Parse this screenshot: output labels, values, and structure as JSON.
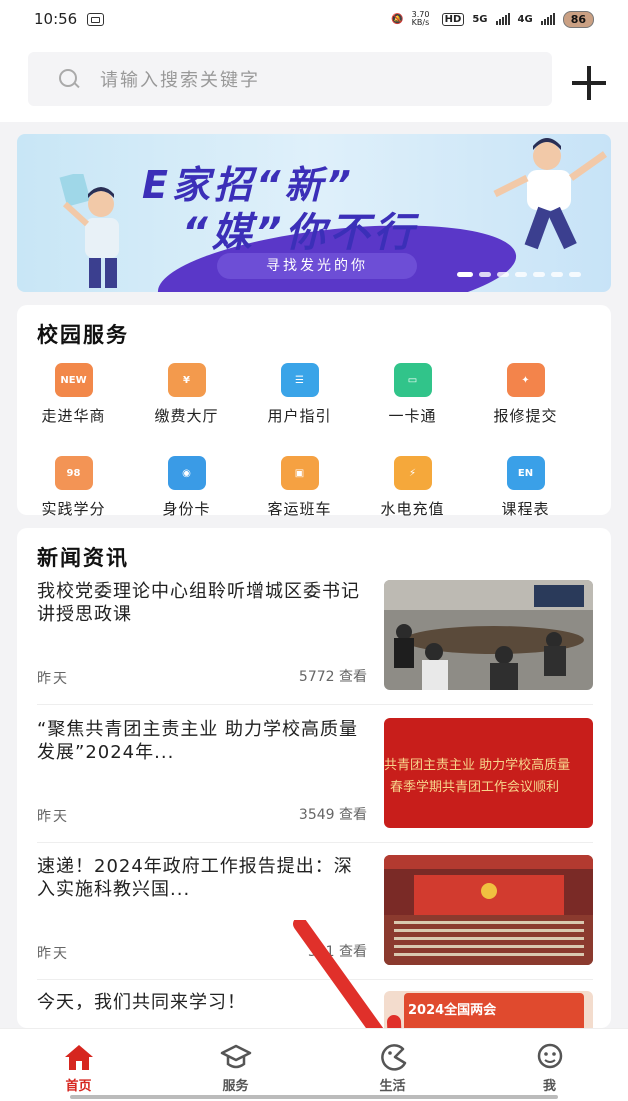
{
  "status_bar": {
    "time": "10:56",
    "speed": "3.70 KB/s",
    "battery": "86",
    "net_labels": [
      "HD",
      "5G",
      "4G"
    ]
  },
  "search": {
    "placeholder": "请输入搜索关键字",
    "icon": "search-icon",
    "add_icon": "plus-icon"
  },
  "banner": {
    "line1": "E家招“新”",
    "line2": "“媒”你不行",
    "subtitle": "寻找发光的你",
    "slide_count": 7,
    "active_slide": 1
  },
  "campus_services": {
    "title": "校园服务",
    "items": [
      {
        "label": "走进华商",
        "icon": "new-icon",
        "color": "#f2884a",
        "glyph": "NEW"
      },
      {
        "label": "缴费大厅",
        "icon": "payment-icon",
        "color": "#f39a4d",
        "glyph": "¥"
      },
      {
        "label": "用户指引",
        "icon": "guide-icon",
        "color": "#3aa4e8",
        "glyph": "☰"
      },
      {
        "label": "一卡通",
        "icon": "card-icon",
        "color": "#31c48a",
        "glyph": "▭"
      },
      {
        "label": "报修提交",
        "icon": "repair-icon",
        "color": "#f3844b",
        "glyph": "✦"
      },
      {
        "label": "实践学分",
        "icon": "credit-icon",
        "color": "#f39455",
        "glyph": "98"
      },
      {
        "label": "身份卡",
        "icon": "id-card-icon",
        "color": "#3a9be6",
        "glyph": "◉"
      },
      {
        "label": "客运班车",
        "icon": "bus-icon",
        "color": "#f5a142",
        "glyph": "▣"
      },
      {
        "label": "水电充值",
        "icon": "utility-icon",
        "color": "#f5a83b",
        "glyph": "⚡"
      },
      {
        "label": "课程表",
        "icon": "schedule-icon",
        "color": "#3aa0e8",
        "glyph": "EN"
      }
    ]
  },
  "news": {
    "title": "新闻资讯",
    "items": [
      {
        "title": "我校党委理论中心组聆听增城区委书记讲授思政课",
        "date": "昨天",
        "views": "5772 查看",
        "thumb_color": "#6b6a67"
      },
      {
        "title": "“聚焦共青团主责主业 助力学校高质量发展”2024年...",
        "date": "昨天",
        "views": "3549 查看",
        "thumb_color": "#c81e1b"
      },
      {
        "title": "速递！2024年政府工作报告提出：深入实施科教兴国...",
        "date": "昨天",
        "views": "321 查看",
        "thumb_color": "#a3302a"
      },
      {
        "title": "今天，我们共同来学习！",
        "date": "",
        "views": "",
        "thumb_color": "#e04a2e"
      }
    ],
    "thumb_texts": [
      "共青团主责主业 助力学校高质量",
      "春季学期共青团工作会议顺利",
      "2024全国两会"
    ]
  },
  "tabbar": {
    "tabs": [
      {
        "label": "首页",
        "icon": "home-icon",
        "active": true
      },
      {
        "label": "服务",
        "icon": "graduation-cap-icon",
        "active": false
      },
      {
        "label": "生活",
        "icon": "life-icon",
        "active": false
      },
      {
        "label": "我",
        "icon": "profile-icon",
        "active": false
      }
    ]
  },
  "colors": {
    "accent": "#d6261f",
    "banner_text": "#3b2fb8",
    "background": "#f3f3f5"
  }
}
